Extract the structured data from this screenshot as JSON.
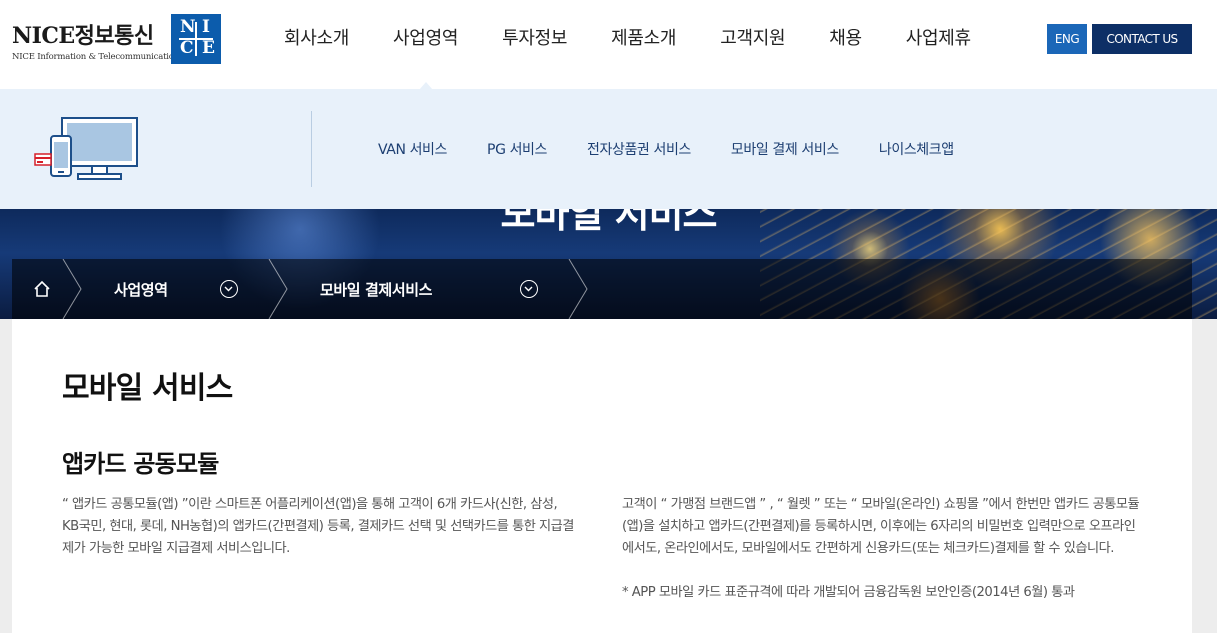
{
  "header": {
    "logo": {
      "main": "NICE정보통신",
      "sub": "NICE Information & Telecommunication",
      "box_letters": [
        "N",
        "I",
        "C",
        "E"
      ]
    },
    "nav": [
      {
        "label": "회사소개",
        "active": false
      },
      {
        "label": "사업영역",
        "active": true
      },
      {
        "label": "투자정보",
        "active": false
      },
      {
        "label": "제품소개",
        "active": false
      },
      {
        "label": "고객지원",
        "active": false
      },
      {
        "label": "채용",
        "active": false
      },
      {
        "label": "사업제휴",
        "active": false
      }
    ],
    "eng_label": "ENG",
    "contact_label": "CONTACT US"
  },
  "submenu": {
    "items": [
      "VAN 서비스",
      "PG 서비스",
      "전자상품권 서비스",
      "모바일 결제 서비스",
      "나이스체크앱"
    ]
  },
  "visual": {
    "title": "모바일 서비스"
  },
  "breadcrumb": {
    "level1": "사업영역",
    "level2": "모바일 결제서비스"
  },
  "content": {
    "page_title": "모바일 서비스",
    "section_title": "앱카드 공동모듈",
    "para_left": "“ 앱카드 공통모듈(앱) ”이란 스마트폰 어플리케이션(앱)을 통해 고객이 6개 카드사(신한, 삼성, KB국민, 현대, 롯데, NH농협)의 앱카드(간편결제) 등록, 결제카드 선택 및 선택카드를 통한 지급결제가 가능한 모바일 지급결제 서비스입니다.",
    "para_right": "고객이 “ 가맹점 브랜드앱 ” , “ 월렛 ” 또는 “ 모바일(온라인) 쇼핑몰 ”에서 한번만 앱카드 공통모듈(앱)을 설치하고 앱카드(간편결제)를 등록하시면, 이후에는 6자리의 비밀번호 입력만으로 오프라인에서도, 온라인에서도, 모바일에서도 간편하게 신용카드(또는 체크카드)결제를 할 수 있습니다.",
    "note": "* APP 모바일 카드 표준규격에 따라 개발되어 금융감독원 보안인증(2014년 6월) 통과"
  },
  "colors": {
    "logo_blue": "#0c5cac",
    "eng_button": "#1b67b8",
    "contact_button": "#0d2f66",
    "submenu_bg": "#e8f1fa",
    "submenu_text": "#1d3f72"
  },
  "icons": [
    "home-icon",
    "chevron-down-icon",
    "device-illustration-icon"
  ]
}
